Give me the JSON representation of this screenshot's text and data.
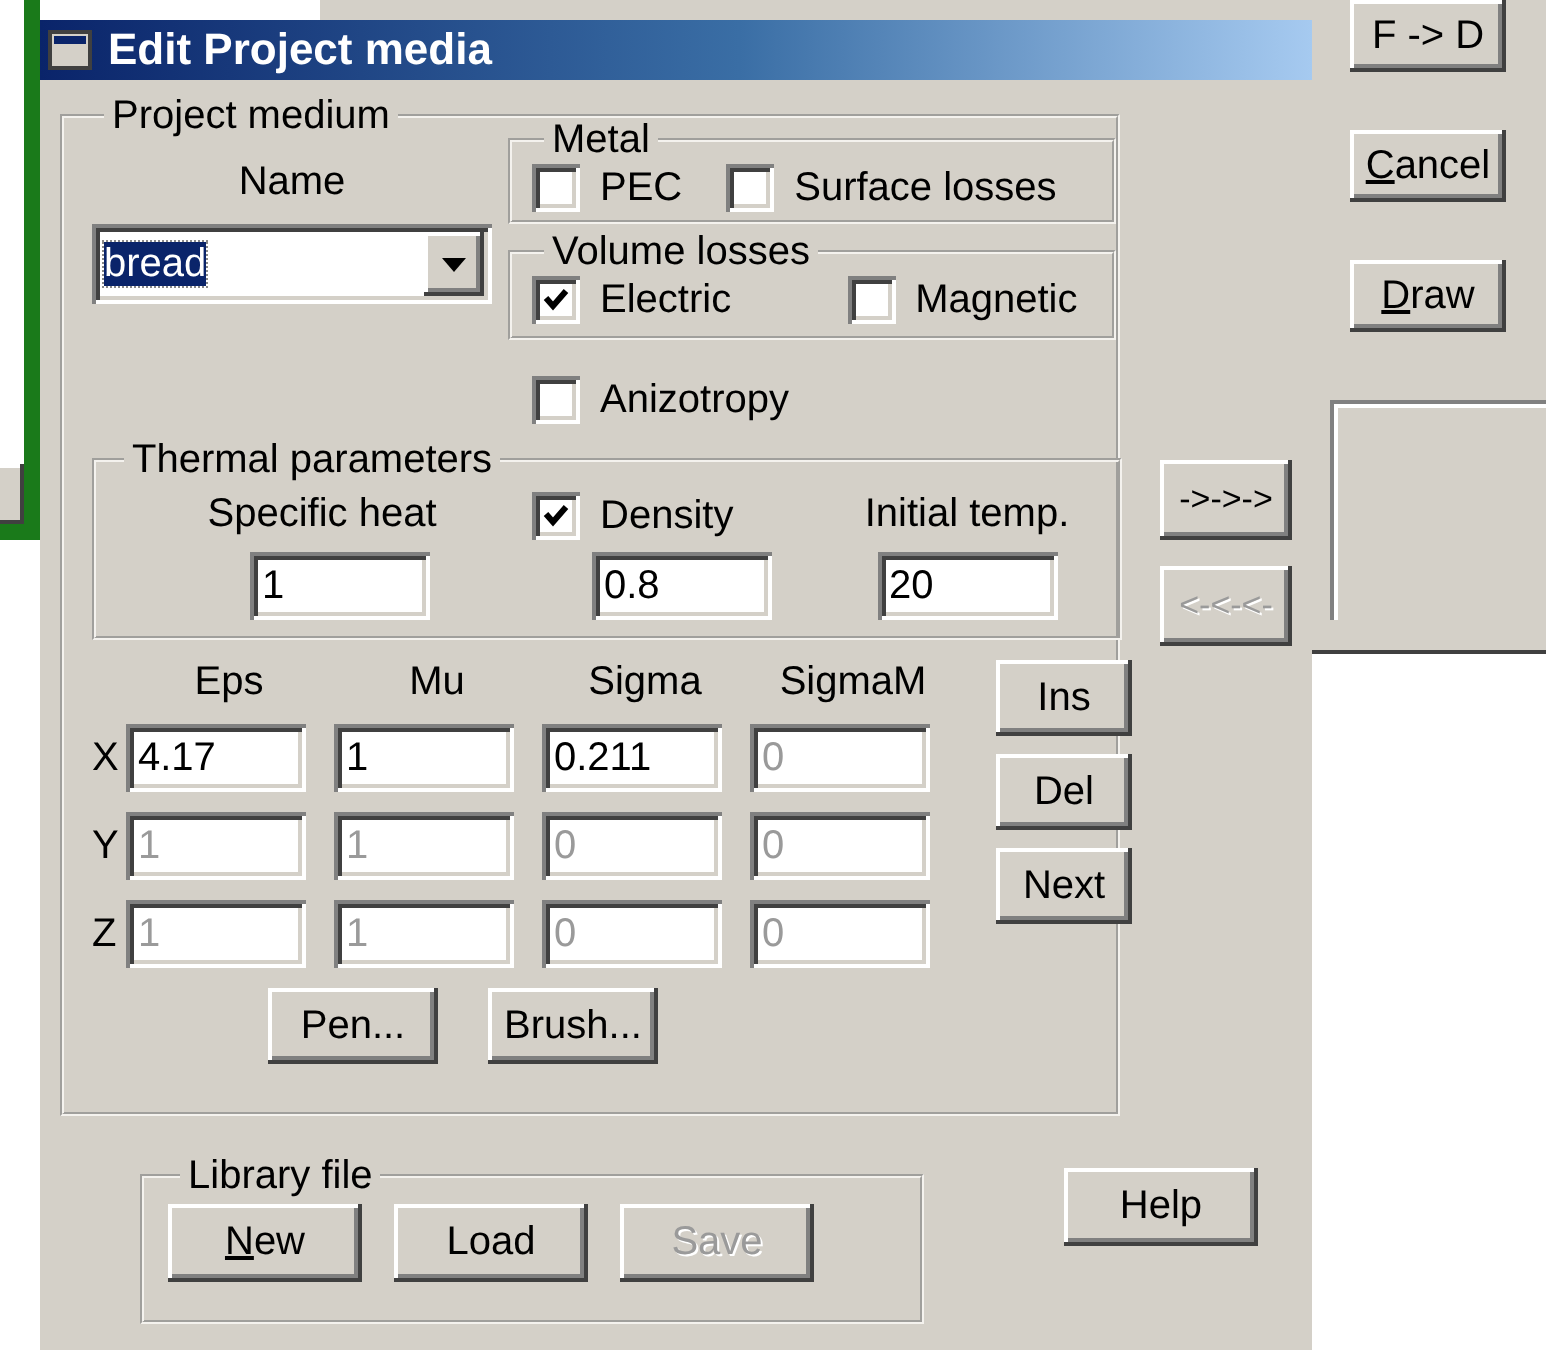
{
  "background_window": {
    "buttons": [
      {
        "label": "F -> D",
        "underline_first": false
      },
      {
        "label": "Cancel",
        "underline_first": true
      },
      {
        "label": "Draw",
        "underline_first": true
      }
    ]
  },
  "dialog": {
    "title": "Edit Project media",
    "project_medium": {
      "title": "Project medium",
      "name_label": "Name",
      "name_value": "bread",
      "metal": {
        "title": "Metal",
        "options": [
          {
            "label": "PEC",
            "checked": false
          },
          {
            "label": "Surface losses",
            "checked": false
          }
        ]
      },
      "volume_losses": {
        "title": "Volume losses",
        "options": [
          {
            "label": "Electric",
            "checked": true
          },
          {
            "label": "Magnetic",
            "checked": false
          }
        ]
      },
      "anizotropy": {
        "label": "Anizotropy",
        "checked": false
      },
      "thermal": {
        "title": "Thermal parameters",
        "specific_heat": {
          "label": "Specific heat",
          "value": "1"
        },
        "density": {
          "label": "Density",
          "checked": true,
          "value": "0.8"
        },
        "initial_temp": {
          "label": "Initial temp.",
          "value": "20"
        }
      },
      "tensor": {
        "columns": [
          "Eps",
          "Mu",
          "Sigma",
          "SigmaM"
        ],
        "rows": [
          {
            "axis": "X",
            "cells": [
              {
                "value": "4.17",
                "disabled": false
              },
              {
                "value": "1",
                "disabled": false
              },
              {
                "value": "0.211",
                "disabled": false
              },
              {
                "value": "0",
                "disabled": true
              }
            ]
          },
          {
            "axis": "Y",
            "cells": [
              {
                "value": "1",
                "disabled": true
              },
              {
                "value": "1",
                "disabled": true
              },
              {
                "value": "0",
                "disabled": true
              },
              {
                "value": "0",
                "disabled": true
              }
            ]
          },
          {
            "axis": "Z",
            "cells": [
              {
                "value": "1",
                "disabled": true
              },
              {
                "value": "1",
                "disabled": true
              },
              {
                "value": "0",
                "disabled": true
              },
              {
                "value": "0",
                "disabled": true
              }
            ]
          }
        ]
      },
      "side_buttons": [
        {
          "label": "Ins"
        },
        {
          "label": "Del"
        },
        {
          "label": "Next"
        }
      ],
      "style_buttons": [
        {
          "label": "Pen..."
        },
        {
          "label": "Brush..."
        }
      ]
    },
    "transfer_buttons": [
      {
        "label": "->->->",
        "disabled": false
      },
      {
        "label": "<-<-<-",
        "disabled": true
      }
    ],
    "library": {
      "title": "Library file",
      "buttons": [
        {
          "label": "New",
          "underline_first": true,
          "disabled": false
        },
        {
          "label": "Load",
          "underline_first": false,
          "disabled": false
        },
        {
          "label": "Save",
          "underline_first": false,
          "disabled": true
        }
      ]
    },
    "help_button": {
      "label": "Help"
    }
  }
}
